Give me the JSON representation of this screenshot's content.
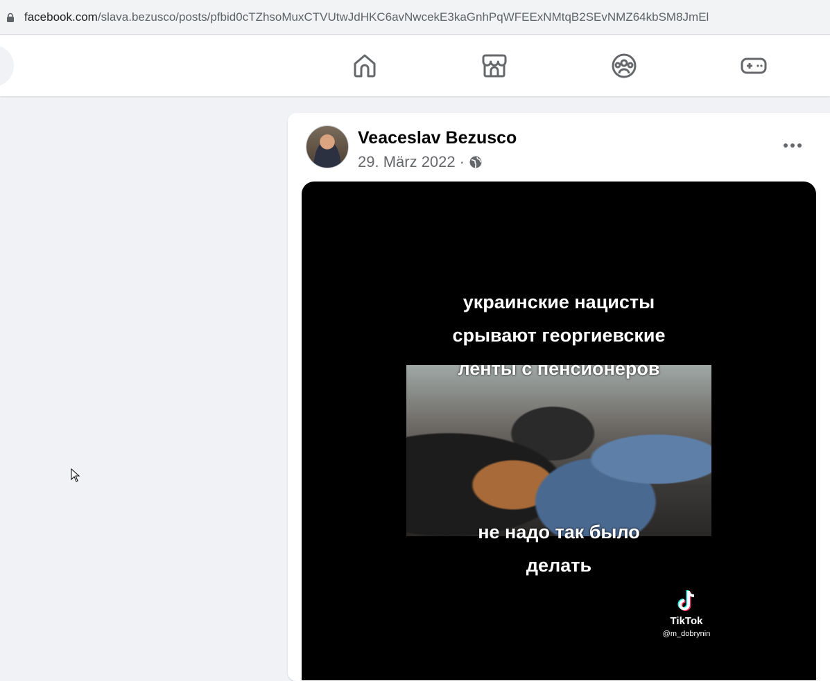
{
  "browser": {
    "url_domain": "facebook.com",
    "url_path": "/slava.bezusco/posts/pfbid0cTZhsoMuxCTVUtwJdHKC6avNwcekE3kaGnhPqWFEExNMtqB2SEvNMZ64kbSM8JmEl"
  },
  "nav": {
    "icons": [
      "home-icon",
      "marketplace-icon",
      "groups-icon",
      "gaming-icon"
    ]
  },
  "post": {
    "author": "Veaceslav Bezusco",
    "date": "29. März 2022",
    "separator": "·",
    "visibility_icon": "globe-icon",
    "video": {
      "caption_top": [
        "украинские нацисты",
        "срывают георгиевские",
        "ленты с пенсионеров"
      ],
      "caption_bottom": [
        "не надо так было",
        "делать"
      ],
      "watermark_brand": "TikTok",
      "watermark_user": "@m_dobrynin"
    }
  },
  "colors": {
    "fb_bg": "#f0f2f5",
    "card_bg": "#ffffff",
    "text_primary": "#050505",
    "text_secondary": "#65676b"
  }
}
